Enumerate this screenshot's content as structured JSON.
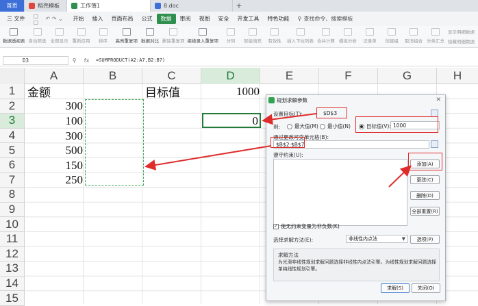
{
  "tabs": [
    {
      "label": "首页",
      "color": "#3d6fd9"
    },
    {
      "label": "稻壳模板",
      "color": "#e0473a"
    },
    {
      "label": "工作簿1",
      "color": "#2f8f4e"
    },
    {
      "label": "8.doc",
      "color": "#3d6fd9"
    }
  ],
  "menu": {
    "file": "三 文件",
    "items": [
      "开始",
      "插入",
      "页面布局",
      "公式",
      "数据",
      "审阅",
      "视图",
      "安全",
      "开发工具",
      "特色功能"
    ],
    "active": "数据",
    "search": "查找命令、搜索模板"
  },
  "toolbar": {
    "items": [
      "数据透视表",
      "自动筛选",
      "全部显示",
      "重新应用",
      "排序",
      "高亮重复项",
      "数据对比",
      "删除重复项",
      "拒绝录入重复项",
      "分列",
      "智能填充",
      "有效性",
      "插入下拉列表",
      "合并计算",
      "模拟分析",
      "记录单",
      "创建组",
      "取消组合",
      "分类汇总",
      "显示明细数据",
      "隐藏明细数据"
    ]
  },
  "formula_bar": {
    "name_box": "D3",
    "fx": "fx",
    "formula": "=SUMPRODUCT(A2:A7,B2:B7)"
  },
  "columns": [
    "A",
    "B",
    "C",
    "D",
    "E",
    "F",
    "G",
    "H"
  ],
  "rows": [
    "1",
    "2",
    "3",
    "4",
    "5",
    "6",
    "7",
    "8",
    "9",
    "10",
    "11",
    "12",
    "13",
    "14",
    "15"
  ],
  "cells": {
    "A1": "金额",
    "C1": "目标值",
    "D1": "1000",
    "A2": "300",
    "A3": "100",
    "A4": "300",
    "A5": "500",
    "A6": "150",
    "A7": "250",
    "D3": "0"
  },
  "dialog": {
    "title": "规划求解参数",
    "close": "✕",
    "set_objective_label": "设置目标(T):",
    "objective_value": "$D$3",
    "to_label": "到:",
    "radio_max": "最大值(M)",
    "radio_min": "最小值(N)",
    "radio_target": "目标值(V):",
    "target_value": "1000",
    "changing_label": "通过更改可变单元格(B):",
    "changing_value": "$B$2:$B$7",
    "constraints_label": "遵守约束(U):",
    "btn_add": "添加(A)",
    "btn_change": "更改(C)",
    "btn_delete": "删除(D)",
    "btn_reset": "全部重置(R)",
    "nonneg_label": "使无约束变量为非负数(K)",
    "method_label": "选择求解方法(E):",
    "method_value": "非线性内点法",
    "btn_options": "选项(P)",
    "method_box_title": "求解方法",
    "method_desc": "为光滑非线性规划求解问题选择非线性内点法引擎。为线性规划求解问题选择单纯线性规划引擎。",
    "btn_solve": "求解(S)",
    "btn_close": "关闭(O)"
  },
  "colors": {
    "accent_green": "#2f8f4e",
    "annotation_red": "#e02b2b",
    "home_blue": "#3d6fd9"
  }
}
